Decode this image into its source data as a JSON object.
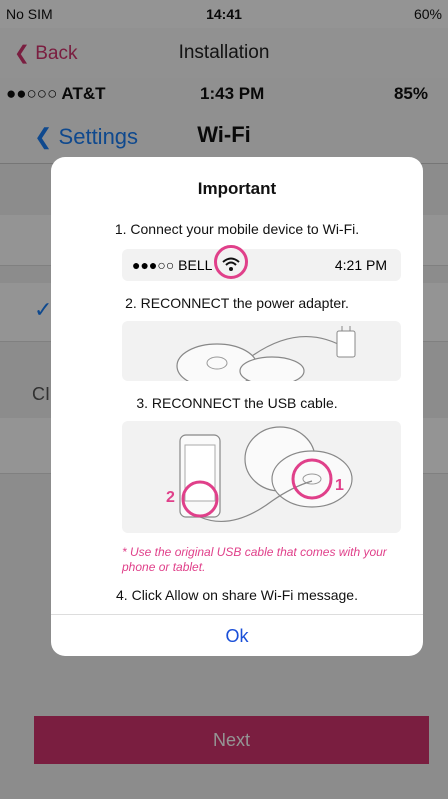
{
  "status": {
    "carrier": "No SIM",
    "time": "14:41",
    "battery": "60%"
  },
  "nav": {
    "back": "Back",
    "title": "Installation"
  },
  "inner": {
    "carrier": "●●○○○ AT&T",
    "time": "1:43 PM",
    "battery": "85%",
    "back": "Settings",
    "title": "Wi-Fi",
    "section": "CI"
  },
  "next_label": "Next",
  "dialog": {
    "title": "Important",
    "step1": "1. Connect your mobile device to Wi-Fi.",
    "wifi_carrier": "●●●○○ BELL",
    "wifi_time": "4:21 PM",
    "step2": "2. RECONNECT the power adapter.",
    "step3": "3. RECONNECT the USB cable.",
    "marker1": "1",
    "marker2": "2",
    "note": "* Use the original USB cable that comes with your phone or tablet.",
    "step4": "4. Click Allow on share Wi-Fi message.",
    "ok": "Ok"
  },
  "colors": {
    "accent": "#d2356f",
    "marker": "#e0408a",
    "ok_blue": "#1a4fd8"
  }
}
